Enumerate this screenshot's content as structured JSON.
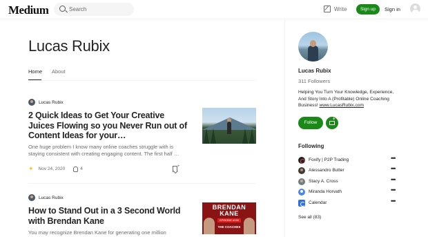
{
  "header": {
    "logo": "Medium",
    "search_placeholder": "Search",
    "write_label": "Write",
    "signup_label": "Sign up",
    "signin_label": "Sign in"
  },
  "profile": {
    "name": "Lucas Rubix",
    "tabs": [
      "Home",
      "About"
    ],
    "active_tab": "Home"
  },
  "posts": [
    {
      "author": "Lucas Rubix",
      "title": "2 Quick Ideas to Get Your Creative Juices Flowing so you Never Run out of Content Ideas for your…",
      "excerpt": "One huge problem I know many online coaches struggle with is staying consistent with creating engaging content. The first half …",
      "date": "Nov 24, 2020",
      "claps": "4"
    },
    {
      "author": "Lucas Rubix",
      "title": "How to Stand Out in a 3 Second World with Brendan Kane",
      "excerpt": "You may recognize Brendan Kane for generating one million",
      "thumbnail_text": {
        "name": "BRENDAN KANE",
        "episode": "EPISODE #190",
        "subtitle": "THE COACHES"
      }
    }
  ],
  "sidebar": {
    "name": "Lucas Rubix",
    "followers": "311 Followers",
    "bio": "Helping You Turn Your Knowledge, Experience, And Story Into A (Profitable) Online Coaching Business!",
    "bio_link": "www.LucasRubix.com",
    "follow_label": "Follow",
    "following_heading": "Following",
    "following": [
      {
        "name": "Foxify | P2P Trading"
      },
      {
        "name": "Alessandro Butter"
      },
      {
        "name": "Stacy A. Cross"
      },
      {
        "name": "Miranda Horvath"
      },
      {
        "name": "Calendar"
      }
    ],
    "see_all": "See all (83)"
  },
  "colors": {
    "brand_green": "#1a8917",
    "star": "#ffc017",
    "text": "#242424",
    "muted": "#6b6b6b"
  }
}
